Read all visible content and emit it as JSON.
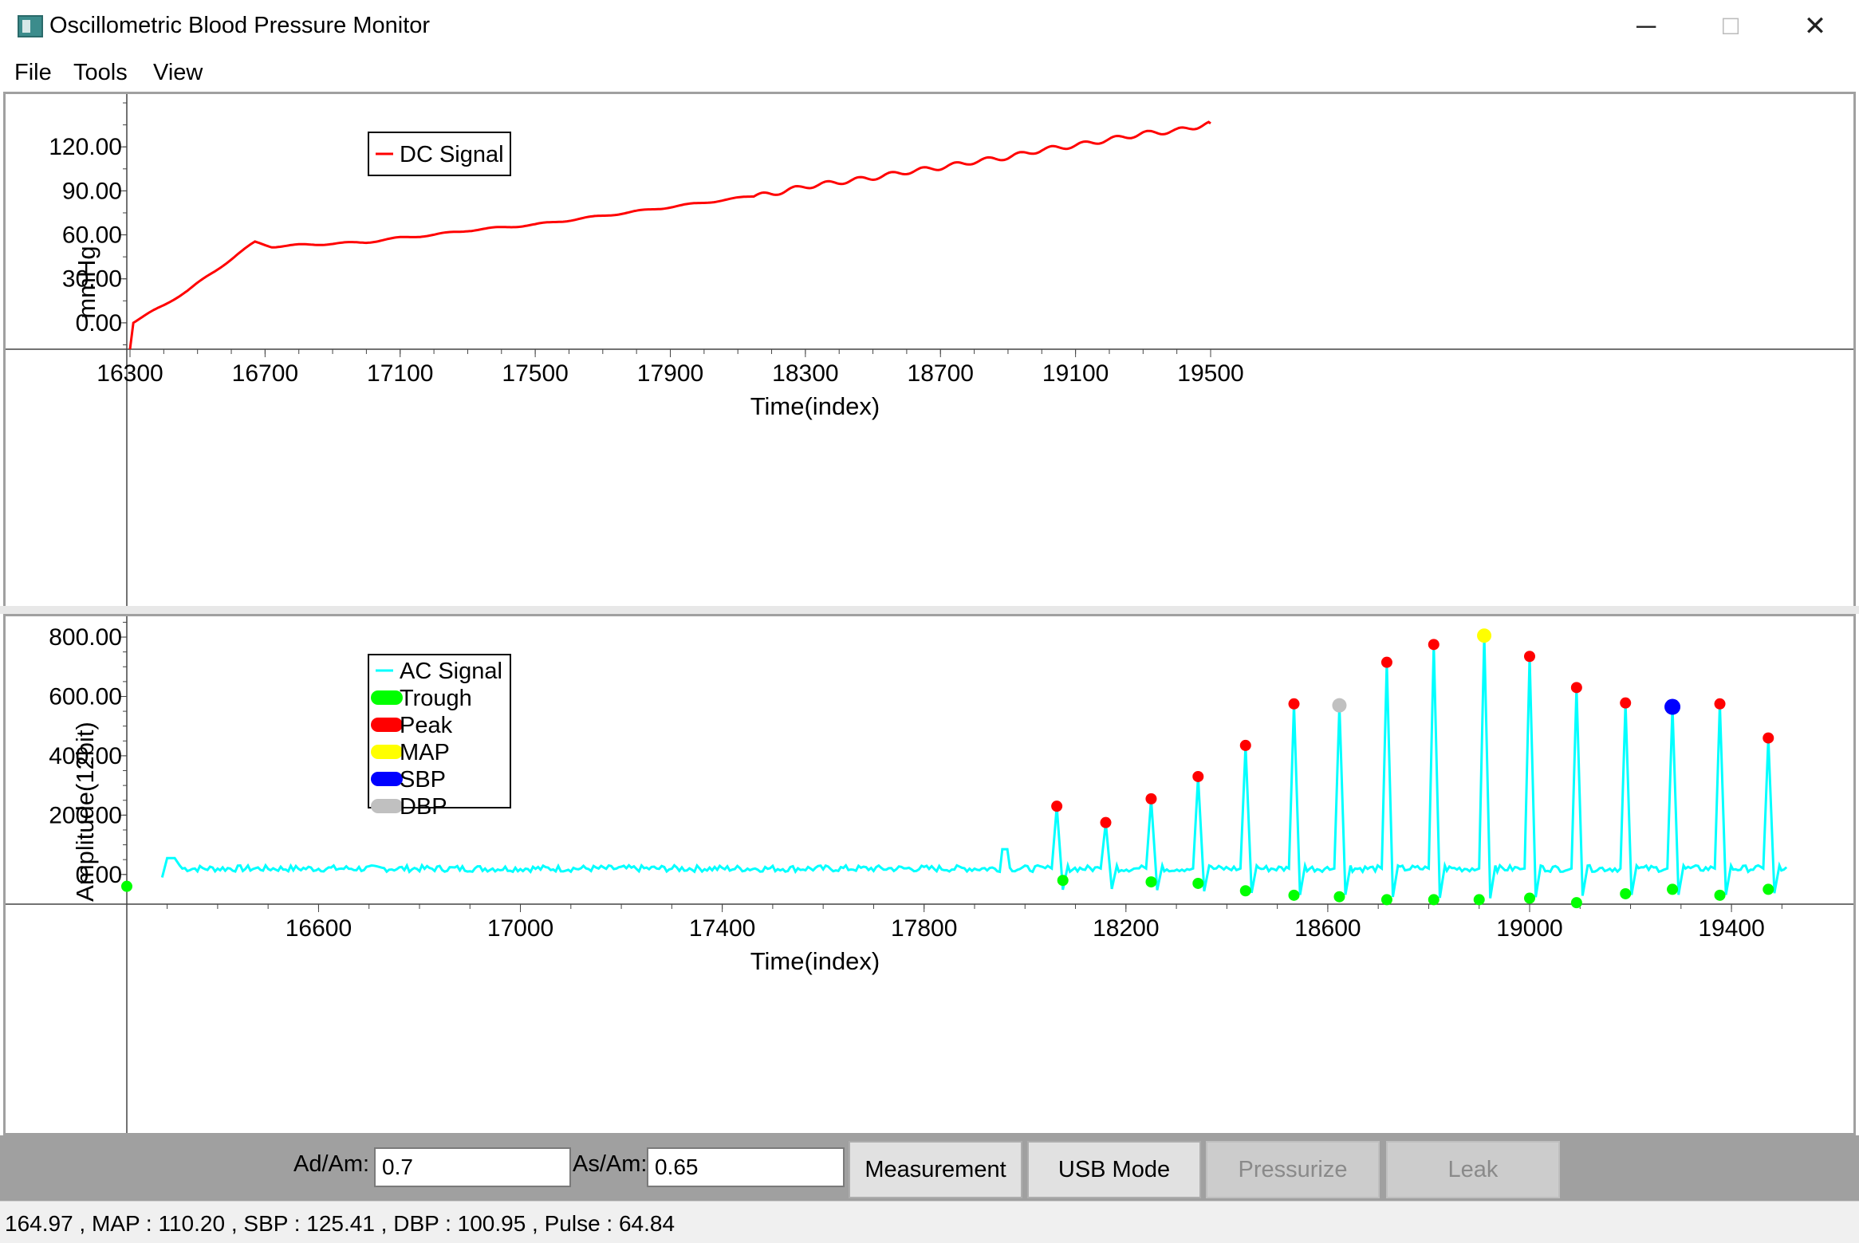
{
  "window": {
    "title": "Oscillometric Blood Pressure Monitor",
    "minimize_glyph": "─",
    "maximize_glyph": "☐",
    "close_glyph": "✕"
  },
  "menu": [
    "File",
    "Tools",
    "View"
  ],
  "toolbar": {
    "ad_am_label": "Ad/Am:",
    "ad_am_value": "0.7",
    "as_am_label": "As/Am:",
    "as_am_value": "0.65",
    "buttons": [
      {
        "label": "Measurement",
        "enabled": true
      },
      {
        "label": "USB Mode",
        "enabled": true
      },
      {
        "label": "Pressurize",
        "enabled": false
      },
      {
        "label": "Leak",
        "enabled": false
      }
    ]
  },
  "status": "164.97 , MAP : 110.20 , SBP : 125.41 , DBP : 100.95 , Pulse : 64.84",
  "colors": {
    "dc_signal": "#ff0000",
    "ac_signal": "#00ffff",
    "trough": "#00ff00",
    "peak": "#ff0000",
    "map": "#ffff00",
    "sbp": "#0000ff",
    "dbp": "#c0c0c0"
  },
  "chart_data": [
    {
      "type": "line",
      "xlabel": "Time(index)",
      "ylabel": "mmHg",
      "xlim": [
        16300,
        19500
      ],
      "ylim": [
        -18,
        156
      ],
      "x_ticks": [
        16300,
        16700,
        17100,
        17500,
        17900,
        18300,
        18700,
        19100,
        19500
      ],
      "y_ticks": [
        "0.00",
        "30.00",
        "60.00",
        "90.00",
        "120.00"
      ],
      "legend": "top-left",
      "series": [
        {
          "name": "DC Signal",
          "x": [
            16300,
            16310,
            16330,
            16400,
            16470,
            16550,
            16620,
            16670,
            16720,
            16800,
            16900,
            17000,
            17100,
            17200,
            17300,
            17400,
            17500,
            17600,
            17700,
            17800,
            17900,
            18000,
            18100,
            18200,
            18300,
            18400,
            18500,
            18600,
            18700,
            18800,
            18900,
            19000,
            19100,
            19200,
            19300,
            19400,
            19500
          ],
          "y": [
            -18,
            0,
            3,
            12,
            22,
            35,
            47,
            55,
            52,
            53,
            54,
            55,
            58,
            60,
            63,
            65,
            67,
            70,
            73,
            76,
            79,
            82,
            85,
            88,
            93,
            96,
            99,
            103,
            106,
            110,
            113,
            118,
            121,
            125,
            129,
            131,
            136
          ]
        }
      ]
    },
    {
      "type": "line",
      "xlabel": "Time(index)",
      "ylabel": "Amplitude(12bit)",
      "xlim": [
        16220,
        19550
      ],
      "ylim": [
        -100,
        870
      ],
      "x_ticks": [
        16600,
        17000,
        17400,
        17800,
        18200,
        18600,
        19000,
        19400
      ],
      "y_ticks": [
        "0.00",
        "200.00",
        "400.00",
        "600.00",
        "800.00"
      ],
      "legend": "top-left",
      "series": [
        {
          "name": "AC Signal",
          "baseline": 20
        },
        {
          "name": "Peak",
          "x": [
            18063,
            18160,
            18250,
            18343,
            18437,
            18533,
            18717,
            18810,
            19000,
            19093,
            19190,
            19377,
            19473
          ],
          "y": [
            230,
            175,
            255,
            330,
            435,
            575,
            715,
            775,
            735,
            630,
            578,
            575,
            460
          ]
        },
        {
          "name": "MAP",
          "x": [
            18910
          ],
          "y": [
            805
          ]
        },
        {
          "name": "SBP",
          "x": [
            19283
          ],
          "y": [
            565
          ]
        },
        {
          "name": "DBP",
          "x": [
            18623
          ],
          "y": [
            570
          ]
        },
        {
          "name": "Trough",
          "x": [
            16220,
            18075,
            18250,
            18343,
            18437,
            18533,
            18623,
            18717,
            18810,
            18900,
            19000,
            19093,
            19190,
            19283,
            19377,
            19473
          ],
          "y": [
            -40,
            -20,
            -25,
            -30,
            -55,
            -70,
            -75,
            -85,
            -85,
            -85,
            -80,
            -95,
            -65,
            -50,
            -70,
            -50
          ]
        }
      ]
    }
  ]
}
